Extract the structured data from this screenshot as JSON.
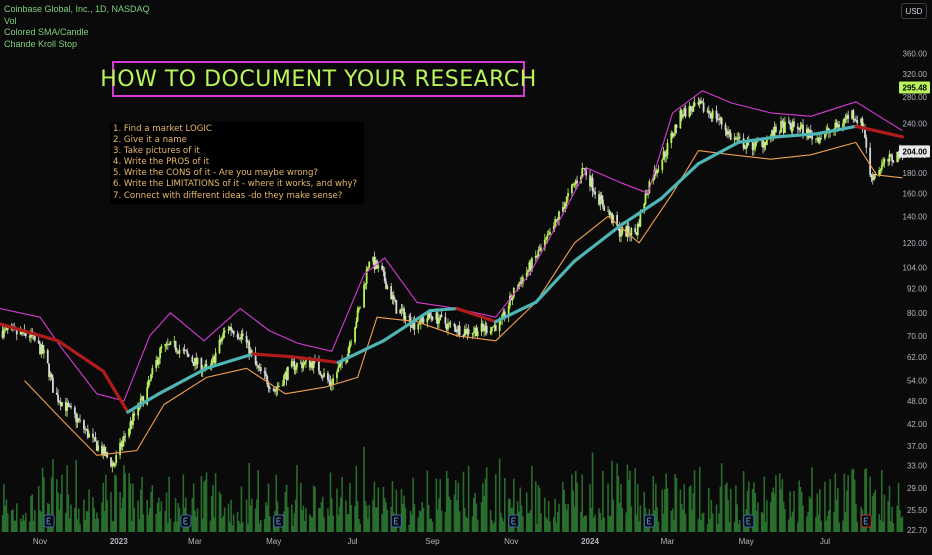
{
  "legend": {
    "symbol": "Coinbase Global, Inc., 1D, NASDAQ",
    "indicators": [
      "Vol",
      "Colored SMA/Candle",
      "Chande Kroll Stop"
    ]
  },
  "currency_label": "USD",
  "title_text": "HOW TO DOCUMENT YOUR RESEARCH",
  "steps": [
    "1. Find a market LOGIC",
    "2. Give it a name",
    "3. Take pictures of it",
    "4. Write the PROS of it",
    "5. Write the CONS of it - Are you maybe wrong?",
    "6. Write the LIMITATIONS of it - where it works, and why?",
    "7. Connect with different ideas -do they make sense?"
  ],
  "colors": {
    "background": "#0a0a0a",
    "candle_up": "#b9f45b",
    "candle_down": "#d8d8d8",
    "sma_up": "#4fb6b6",
    "sma_down": "#b01c1c",
    "stop_high": "#d63bd6",
    "stop_low": "#f0a050",
    "volume": "#2e7d32",
    "title_border": "#d63bd6",
    "title_text": "#b9f45b",
    "steps_text": "#e8b96a",
    "price_badge": "#b9f45b"
  },
  "chart_data": {
    "type": "candlestick",
    "y_scale": "log",
    "ylim": [
      22.7,
      450
    ],
    "x_ticks": [
      "Nov",
      "2023",
      "Mar",
      "May",
      "Jul",
      "Sep",
      "Nov",
      "2024",
      "Mar",
      "May",
      "Jul"
    ],
    "y_ticks": [
      "360.00",
      "320.00",
      "280.00",
      "240.00",
      "200.00",
      "180.00",
      "160.00",
      "140.00",
      "120.00",
      "104.00",
      "92.00",
      "80.00",
      "70.00",
      "62.00",
      "54.00",
      "48.00",
      "42.00",
      "37.00",
      "33.00",
      "29.00",
      "25.50",
      "22.70"
    ],
    "last_price_labels": [
      "295.48",
      "204.00"
    ],
    "close_path": [
      {
        "d": "2022-10-01",
        "c": 72
      },
      {
        "d": "2022-10-25",
        "c": 70
      },
      {
        "d": "2022-11-05",
        "c": 62
      },
      {
        "d": "2022-11-12",
        "c": 50
      },
      {
        "d": "2022-11-25",
        "c": 45
      },
      {
        "d": "2022-12-12",
        "c": 38
      },
      {
        "d": "2022-12-28",
        "c": 33
      },
      {
        "d": "2023-01-10",
        "c": 42
      },
      {
        "d": "2023-01-22",
        "c": 50
      },
      {
        "d": "2023-02-03",
        "c": 65
      },
      {
        "d": "2023-02-14",
        "c": 66
      },
      {
        "d": "2023-03-01",
        "c": 60
      },
      {
        "d": "2023-03-12",
        "c": 57
      },
      {
        "d": "2023-03-26",
        "c": 74
      },
      {
        "d": "2023-04-07",
        "c": 70
      },
      {
        "d": "2023-04-18",
        "c": 58
      },
      {
        "d": "2023-05-02",
        "c": 51
      },
      {
        "d": "2023-05-16",
        "c": 59
      },
      {
        "d": "2023-06-01",
        "c": 60
      },
      {
        "d": "2023-06-14",
        "c": 53
      },
      {
        "d": "2023-06-26",
        "c": 62
      },
      {
        "d": "2023-07-08",
        "c": 85
      },
      {
        "d": "2023-07-14",
        "c": 110
      },
      {
        "d": "2023-07-24",
        "c": 100
      },
      {
        "d": "2023-08-04",
        "c": 82
      },
      {
        "d": "2023-08-18",
        "c": 75
      },
      {
        "d": "2023-09-01",
        "c": 79
      },
      {
        "d": "2023-09-14",
        "c": 74
      },
      {
        "d": "2023-09-28",
        "c": 72
      },
      {
        "d": "2023-10-12",
        "c": 73
      },
      {
        "d": "2023-10-24",
        "c": 75
      },
      {
        "d": "2023-11-03",
        "c": 90
      },
      {
        "d": "2023-11-16",
        "c": 105
      },
      {
        "d": "2023-12-01",
        "c": 125
      },
      {
        "d": "2023-12-12",
        "c": 150
      },
      {
        "d": "2023-12-27",
        "c": 185
      },
      {
        "d": "2024-01-08",
        "c": 155
      },
      {
        "d": "2024-01-24",
        "c": 128
      },
      {
        "d": "2024-02-06",
        "c": 128
      },
      {
        "d": "2024-02-16",
        "c": 170
      },
      {
        "d": "2024-02-29",
        "c": 205
      },
      {
        "d": "2024-03-12",
        "c": 255
      },
      {
        "d": "2024-03-26",
        "c": 265
      },
      {
        "d": "2024-04-08",
        "c": 250
      },
      {
        "d": "2024-04-20",
        "c": 220
      },
      {
        "d": "2024-05-03",
        "c": 210
      },
      {
        "d": "2024-05-14",
        "c": 215
      },
      {
        "d": "2024-05-28",
        "c": 235
      },
      {
        "d": "2024-06-10",
        "c": 235
      },
      {
        "d": "2024-06-24",
        "c": 220
      },
      {
        "d": "2024-07-08",
        "c": 232
      },
      {
        "d": "2024-07-22",
        "c": 255
      },
      {
        "d": "2024-07-31",
        "c": 235
      },
      {
        "d": "2024-08-05",
        "c": 175
      },
      {
        "d": "2024-08-16",
        "c": 190
      },
      {
        "d": "2024-08-30",
        "c": 204
      }
    ],
    "sma_path": [
      {
        "d": "2022-10-01",
        "v": 75
      },
      {
        "d": "2022-11-15",
        "v": 68
      },
      {
        "d": "2022-12-20",
        "v": 57
      },
      {
        "d": "2023-01-08",
        "v": 45
      },
      {
        "d": "2023-02-01",
        "v": 50
      },
      {
        "d": "2023-03-10",
        "v": 58
      },
      {
        "d": "2023-04-15",
        "v": 63
      },
      {
        "d": "2023-05-15",
        "v": 62
      },
      {
        "d": "2023-06-20",
        "v": 60
      },
      {
        "d": "2023-07-25",
        "v": 68
      },
      {
        "d": "2023-08-30",
        "v": 81
      },
      {
        "d": "2023-09-20",
        "v": 82
      },
      {
        "d": "2023-10-20",
        "v": 76
      },
      {
        "d": "2023-11-20",
        "v": 85
      },
      {
        "d": "2023-12-20",
        "v": 108
      },
      {
        "d": "2024-01-25",
        "v": 133
      },
      {
        "d": "2024-02-25",
        "v": 155
      },
      {
        "d": "2024-03-25",
        "v": 190
      },
      {
        "d": "2024-04-25",
        "v": 215
      },
      {
        "d": "2024-05-25",
        "v": 222
      },
      {
        "d": "2024-06-25",
        "v": 226
      },
      {
        "d": "2024-07-25",
        "v": 236
      },
      {
        "d": "2024-08-30",
        "v": 222
      }
    ],
    "stop_high_path": [
      {
        "d": "2022-10-01",
        "v": 82
      },
      {
        "d": "2022-11-01",
        "v": 78
      },
      {
        "d": "2022-11-18",
        "v": 65
      },
      {
        "d": "2022-12-15",
        "v": 50
      },
      {
        "d": "2023-01-05",
        "v": 48
      },
      {
        "d": "2023-01-25",
        "v": 70
      },
      {
        "d": "2023-02-10",
        "v": 80
      },
      {
        "d": "2023-03-08",
        "v": 68
      },
      {
        "d": "2023-04-05",
        "v": 82
      },
      {
        "d": "2023-04-28",
        "v": 72
      },
      {
        "d": "2023-05-20",
        "v": 67
      },
      {
        "d": "2023-06-15",
        "v": 64
      },
      {
        "d": "2023-07-10",
        "v": 100
      },
      {
        "d": "2023-07-26",
        "v": 110
      },
      {
        "d": "2023-08-20",
        "v": 85
      },
      {
        "d": "2023-09-20",
        "v": 82
      },
      {
        "d": "2023-10-20",
        "v": 78
      },
      {
        "d": "2023-11-15",
        "v": 100
      },
      {
        "d": "2023-12-10",
        "v": 140
      },
      {
        "d": "2023-12-30",
        "v": 185
      },
      {
        "d": "2024-01-25",
        "v": 170
      },
      {
        "d": "2024-02-15",
        "v": 160
      },
      {
        "d": "2024-03-05",
        "v": 255
      },
      {
        "d": "2024-03-28",
        "v": 290
      },
      {
        "d": "2024-04-20",
        "v": 270
      },
      {
        "d": "2024-05-20",
        "v": 255
      },
      {
        "d": "2024-06-20",
        "v": 250
      },
      {
        "d": "2024-07-25",
        "v": 272
      },
      {
        "d": "2024-08-30",
        "v": 230
      }
    ],
    "stop_low_path": [
      {
        "d": "2022-10-20",
        "v": 54
      },
      {
        "d": "2022-11-15",
        "v": 44
      },
      {
        "d": "2022-12-15",
        "v": 35
      },
      {
        "d": "2023-01-15",
        "v": 36
      },
      {
        "d": "2023-02-05",
        "v": 47
      },
      {
        "d": "2023-03-10",
        "v": 55
      },
      {
        "d": "2023-04-10",
        "v": 58
      },
      {
        "d": "2023-05-10",
        "v": 50
      },
      {
        "d": "2023-06-10",
        "v": 52
      },
      {
        "d": "2023-07-05",
        "v": 55
      },
      {
        "d": "2023-07-20",
        "v": 78
      },
      {
        "d": "2023-08-20",
        "v": 76
      },
      {
        "d": "2023-09-20",
        "v": 70
      },
      {
        "d": "2023-10-20",
        "v": 68
      },
      {
        "d": "2023-11-20",
        "v": 85
      },
      {
        "d": "2023-12-20",
        "v": 120
      },
      {
        "d": "2024-01-15",
        "v": 140
      },
      {
        "d": "2024-02-08",
        "v": 120
      },
      {
        "d": "2024-03-05",
        "v": 160
      },
      {
        "d": "2024-03-25",
        "v": 205
      },
      {
        "d": "2024-04-20",
        "v": 200
      },
      {
        "d": "2024-05-20",
        "v": 195
      },
      {
        "d": "2024-06-20",
        "v": 200
      },
      {
        "d": "2024-07-25",
        "v": 215
      },
      {
        "d": "2024-08-10",
        "v": 178
      },
      {
        "d": "2024-08-30",
        "v": 175
      }
    ],
    "earnings_markers": [
      "2022-11-08",
      "2023-02-22",
      "2023-05-05",
      "2023-08-04",
      "2023-11-03",
      "2024-02-16",
      "2024-05-03",
      "2024-08-02"
    ],
    "series": [
      {
        "name": "Vol"
      },
      {
        "name": "Colored SMA/Candle"
      },
      {
        "name": "Chande Kroll Stop"
      }
    ]
  }
}
